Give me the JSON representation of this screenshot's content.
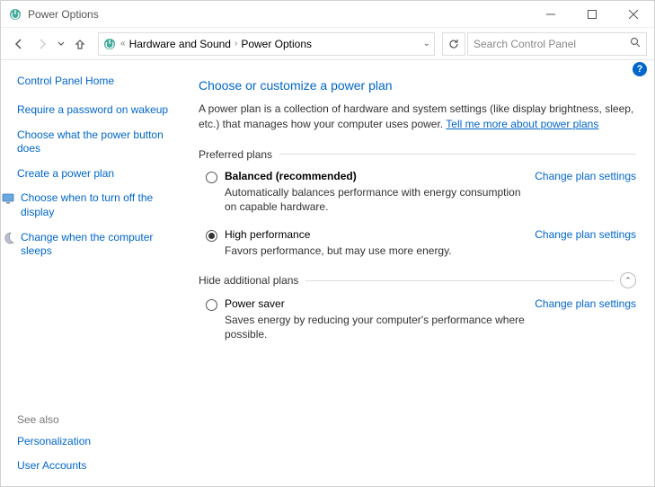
{
  "window": {
    "title": "Power Options"
  },
  "breadcrumb": {
    "prefix": "«",
    "items": [
      "Hardware and Sound",
      "Power Options"
    ]
  },
  "search": {
    "placeholder": "Search Control Panel"
  },
  "sidebar": {
    "home": "Control Panel Home",
    "links": [
      {
        "label": "Require a password on wakeup",
        "icon": null
      },
      {
        "label": "Choose what the power button does",
        "icon": null
      },
      {
        "label": "Create a power plan",
        "icon": null
      },
      {
        "label": "Choose when to turn off the display",
        "icon": "display"
      },
      {
        "label": "Change when the computer sleeps",
        "icon": "moon"
      }
    ],
    "see_also_header": "See also",
    "see_also": [
      "Personalization",
      "User Accounts"
    ]
  },
  "main": {
    "heading": "Choose or customize a power plan",
    "intro_text": "A power plan is a collection of hardware and system settings (like display brightness, sleep, etc.) that manages how your computer uses power. ",
    "intro_link": "Tell me more about power plans",
    "preferred_header": "Preferred plans",
    "hide_header": "Hide additional plans",
    "change_link": "Change plan settings",
    "plans_preferred": [
      {
        "name": "Balanced (recommended)",
        "desc": "Automatically balances performance with energy consumption on capable hardware.",
        "selected": false,
        "bold": true
      },
      {
        "name": "High performance",
        "desc": "Favors performance, but may use more energy.",
        "selected": true,
        "bold": false
      }
    ],
    "plans_additional": [
      {
        "name": "Power saver",
        "desc": "Saves energy by reducing your computer's performance where possible.",
        "selected": false,
        "bold": false
      }
    ]
  }
}
